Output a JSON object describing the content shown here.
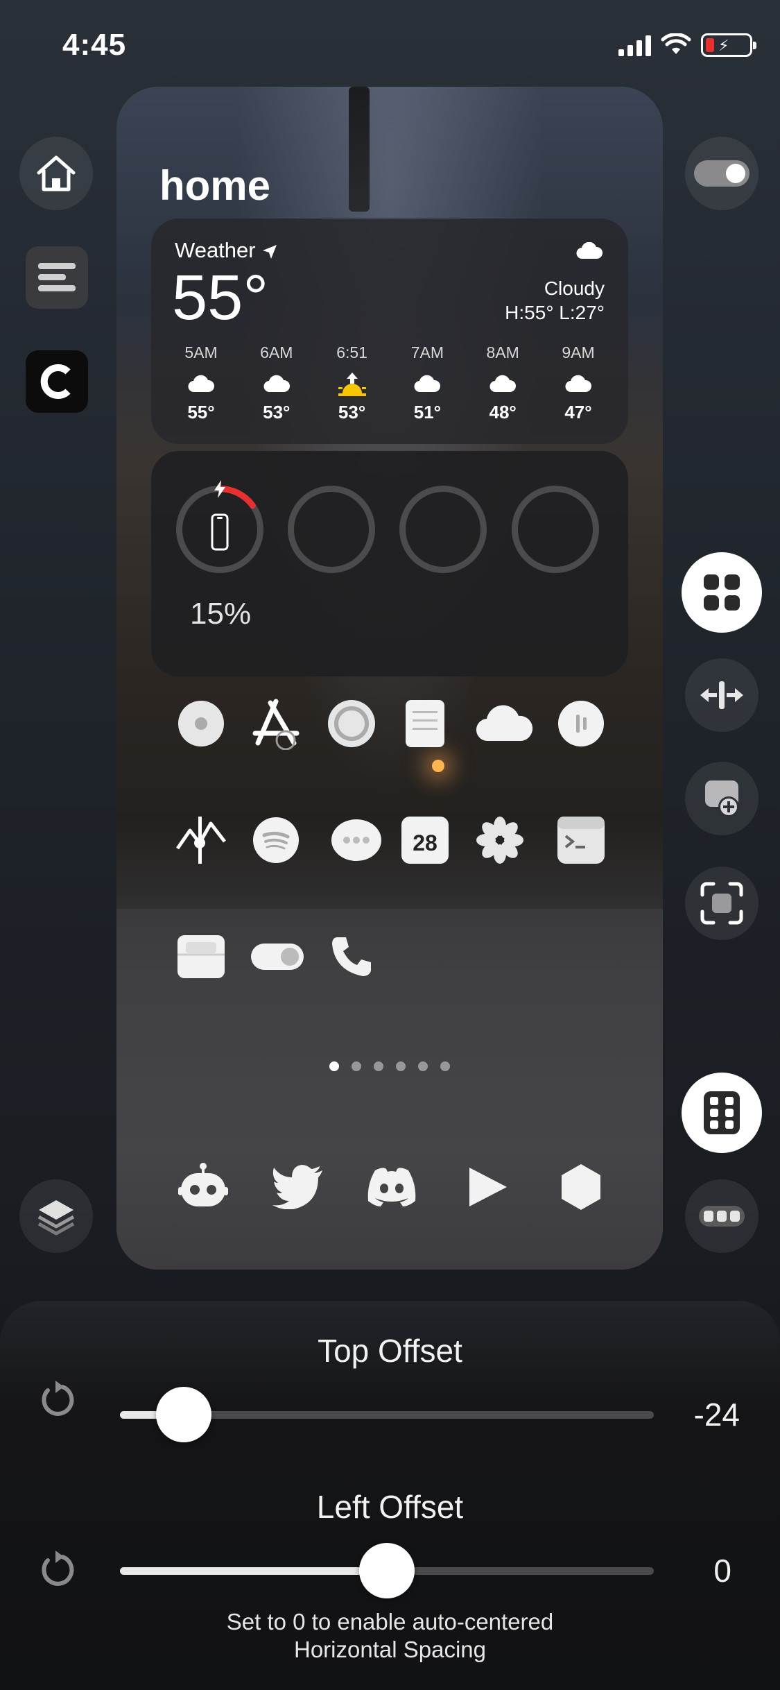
{
  "status_bar": {
    "time": "4:45"
  },
  "preview": {
    "title": "home",
    "weather": {
      "location": "Weather",
      "temperature": "55°",
      "condition": "Cloudy",
      "high_low": "H:55° L:27°",
      "hours": [
        {
          "time": "5AM",
          "icon": "cloud-icon",
          "temp": "55°"
        },
        {
          "time": "6AM",
          "icon": "cloud-icon",
          "temp": "53°"
        },
        {
          "time": "6:51",
          "icon": "sunrise-icon",
          "temp": "53°"
        },
        {
          "time": "7AM",
          "icon": "cloud-icon",
          "temp": "51°"
        },
        {
          "time": "8AM",
          "icon": "cloud-icon",
          "temp": "48°"
        },
        {
          "time": "9AM",
          "icon": "cloud-icon",
          "temp": "47°"
        }
      ]
    },
    "battery": {
      "percent": "15%",
      "level": 0.15
    },
    "calendar_day": "28",
    "page_count": 6,
    "active_page": 0
  },
  "controls": {
    "top_offset": {
      "label": "Top Offset",
      "value": "-24",
      "fraction": 0.12
    },
    "left_offset": {
      "label": "Left Offset",
      "value": "0",
      "fraction": 0.5
    },
    "hint": "Set to 0 to enable auto-centered Horizontal Spacing"
  },
  "colors": {
    "accent_red": "#e8312f",
    "sunrise": "#f7c600",
    "track": "#4a4a4d"
  }
}
